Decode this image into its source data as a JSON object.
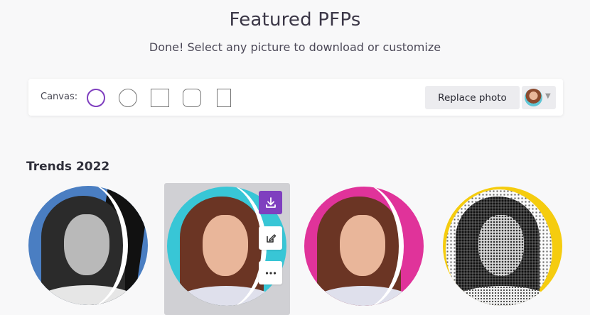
{
  "header": {
    "title": "Featured PFPs",
    "subtitle": "Done! Select any picture to download or customize"
  },
  "toolbar": {
    "canvas_label": "Canvas:",
    "shapes": [
      {
        "name": "circle",
        "selected": true
      },
      {
        "name": "circle",
        "selected": false
      },
      {
        "name": "square",
        "selected": false
      },
      {
        "name": "rounded-square",
        "selected": false
      },
      {
        "name": "portrait-rectangle",
        "selected": false
      }
    ],
    "replace_label": "Replace photo",
    "avatar_dropdown_icon": "chevron-down-icon"
  },
  "section": {
    "title": "Trends 2022"
  },
  "pfps": [
    {
      "background": "#4a7ec2",
      "style": "grayscale cutout",
      "selected": false
    },
    {
      "background": "#38c6d6",
      "style": "color cutout",
      "selected": true
    },
    {
      "background": "#e0339a",
      "style": "color cutout",
      "selected": false
    },
    {
      "background": "#f5cc0f",
      "style": "halftone",
      "selected": false
    }
  ],
  "card_actions": [
    "download-icon",
    "edit-icon",
    "more-icon"
  ],
  "colors": {
    "accent": "#7f3fbf",
    "background": "#f8f8f9",
    "selected_card": "#d0d0d4"
  }
}
